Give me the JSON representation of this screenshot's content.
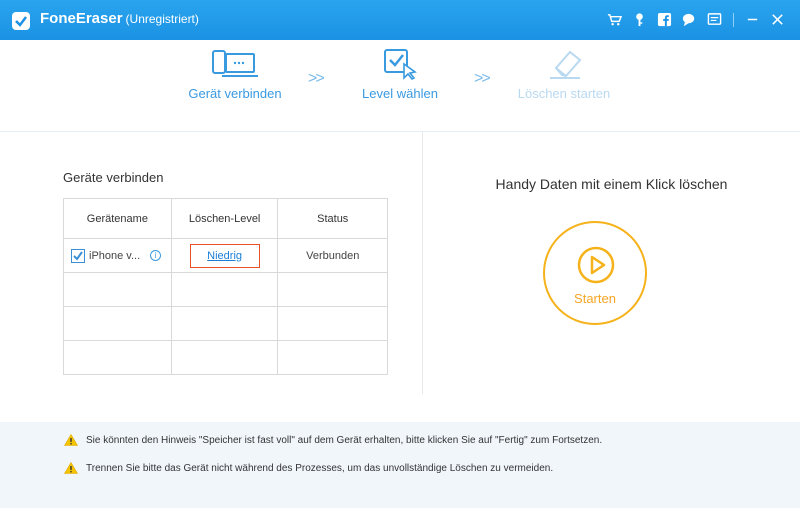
{
  "app": {
    "title": "FoneEraser",
    "subtitle": "(Unregistriert)",
    "icons": [
      "cart-icon",
      "key-icon",
      "facebook-icon",
      "chat-icon",
      "feedback-icon",
      "minimize-icon",
      "close-icon"
    ]
  },
  "steps": [
    {
      "label": "Gerät verbinden",
      "state": "done"
    },
    {
      "label": "Level wählen",
      "state": "active"
    },
    {
      "label": "Löschen starten",
      "state": "disabled"
    }
  ],
  "left": {
    "title": "Geräte verbinden",
    "columns": [
      "Gerätename",
      "Löschen-Level",
      "Status"
    ],
    "rows": [
      {
        "device": "iPhone v...",
        "checked": true,
        "level": "Niedrig",
        "status": "Verbunden"
      }
    ]
  },
  "right": {
    "title": "Handy Daten mit einem Klick löschen",
    "start_label": "Starten"
  },
  "notices": [
    "Sie könnten den Hinweis \"Speicher ist fast voll\" auf dem Gerät erhalten, bitte klicken Sie auf \"Fertig\" zum Fortsetzen.",
    "Trennen Sie bitte das Gerät nicht während des Prozesses, um das unvollständige Löschen zu vermeiden."
  ],
  "colors": {
    "titlebar": "#1b92e4",
    "accent_blue": "#3a9ae0",
    "start_orange": "#f5b21a",
    "highlight_red": "#e8502a"
  }
}
